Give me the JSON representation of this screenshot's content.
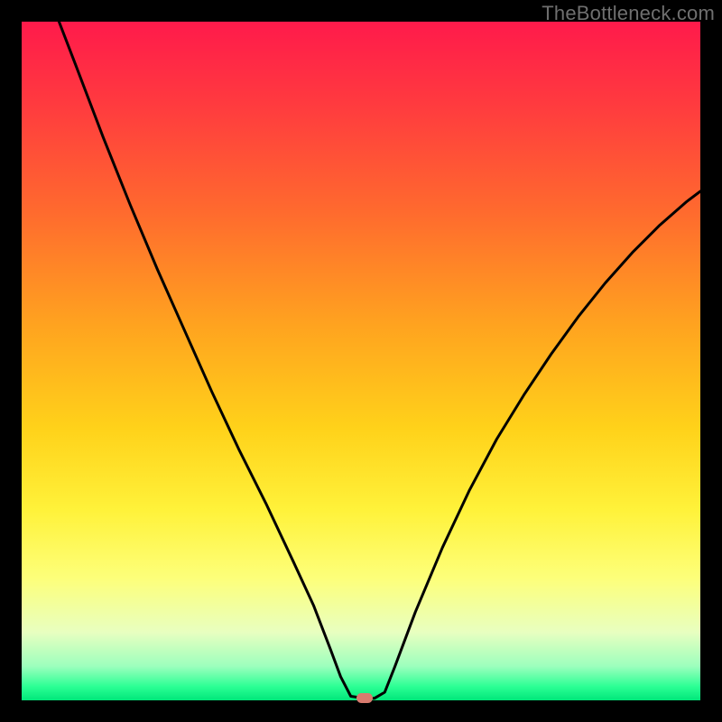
{
  "watermark": "TheBottleneck.com",
  "chart_data": {
    "type": "line",
    "title": "",
    "xlabel": "",
    "ylabel": "",
    "xlim": [
      0,
      1
    ],
    "ylim": [
      0,
      1
    ],
    "series": [
      {
        "name": "curve",
        "x": [
          0.055,
          0.08,
          0.12,
          0.16,
          0.2,
          0.24,
          0.28,
          0.32,
          0.36,
          0.4,
          0.43,
          0.455,
          0.47,
          0.485,
          0.505,
          0.52,
          0.535,
          0.55,
          0.58,
          0.62,
          0.66,
          0.7,
          0.74,
          0.78,
          0.82,
          0.86,
          0.9,
          0.94,
          0.98,
          1.0
        ],
        "y": [
          1.0,
          0.935,
          0.83,
          0.73,
          0.635,
          0.545,
          0.455,
          0.37,
          0.29,
          0.205,
          0.14,
          0.075,
          0.035,
          0.006,
          0.003,
          0.003,
          0.012,
          0.05,
          0.13,
          0.225,
          0.31,
          0.385,
          0.45,
          0.51,
          0.565,
          0.615,
          0.66,
          0.7,
          0.735,
          0.75
        ]
      }
    ],
    "minimum_marker": {
      "x": 0.505,
      "y": 0.003
    },
    "gradient_stops": [
      {
        "pos": 0.0,
        "color": "#ff1a4b"
      },
      {
        "pos": 0.28,
        "color": "#ff6a2e"
      },
      {
        "pos": 0.6,
        "color": "#ffd21a"
      },
      {
        "pos": 0.82,
        "color": "#fdff7a"
      },
      {
        "pos": 0.95,
        "color": "#9cffbd"
      },
      {
        "pos": 1.0,
        "color": "#00e67a"
      }
    ]
  }
}
